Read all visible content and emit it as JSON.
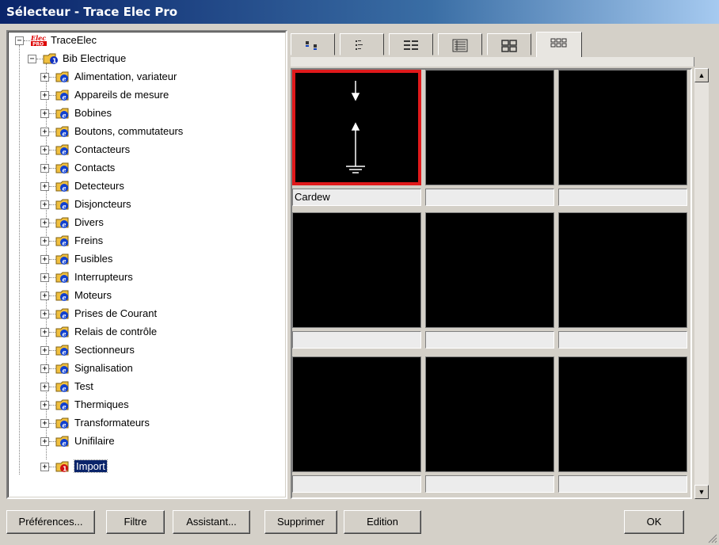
{
  "window": {
    "title": "Sélecteur - Trace Elec Pro"
  },
  "tree": {
    "root": {
      "label": "TraceElec",
      "expander": "−"
    },
    "library": {
      "label": "Bib Electrique",
      "expander": "−"
    },
    "categories": [
      "Alimentation, variateur",
      "Appareils de mesure",
      "Bobines",
      "Boutons, commutateurs",
      "Contacteurs",
      "Contacts",
      "Detecteurs",
      "Disjoncteurs",
      "Divers",
      "Freins",
      "Fusibles",
      "Interrupteurs",
      "Moteurs",
      "Prises de Courant",
      "Relais de contrôle",
      "Sectionneurs",
      "Signalisation",
      "Test",
      "Thermiques",
      "Transformateurs",
      "Unifilaire"
    ],
    "import": {
      "label": "Import",
      "expander": "+",
      "selected": true
    },
    "category_expander": "+"
  },
  "view_tabs": [
    {
      "name": "small-icons",
      "active": false
    },
    {
      "name": "list",
      "active": false
    },
    {
      "name": "details-list",
      "active": false
    },
    {
      "name": "details",
      "active": false
    },
    {
      "name": "large-thumbnails",
      "active": false
    },
    {
      "name": "small-thumbnails",
      "active": true
    }
  ],
  "grid": {
    "rows": [
      {
        "labels": [
          "Cardew",
          "",
          ""
        ],
        "selected_col": 0
      },
      {
        "labels": [
          "",
          "",
          ""
        ]
      },
      {
        "labels": [
          "",
          "",
          ""
        ]
      }
    ],
    "highlight_color": "#e0191b"
  },
  "buttons": {
    "preferences": "Préférences...",
    "filter": "Filtre",
    "assistant": "Assistant...",
    "delete": "Supprimer",
    "edit": "Edition",
    "ok": "OK"
  },
  "colors": {
    "title_start": "#0a246a",
    "title_end": "#a6caf0",
    "selection": "#0a246a"
  }
}
